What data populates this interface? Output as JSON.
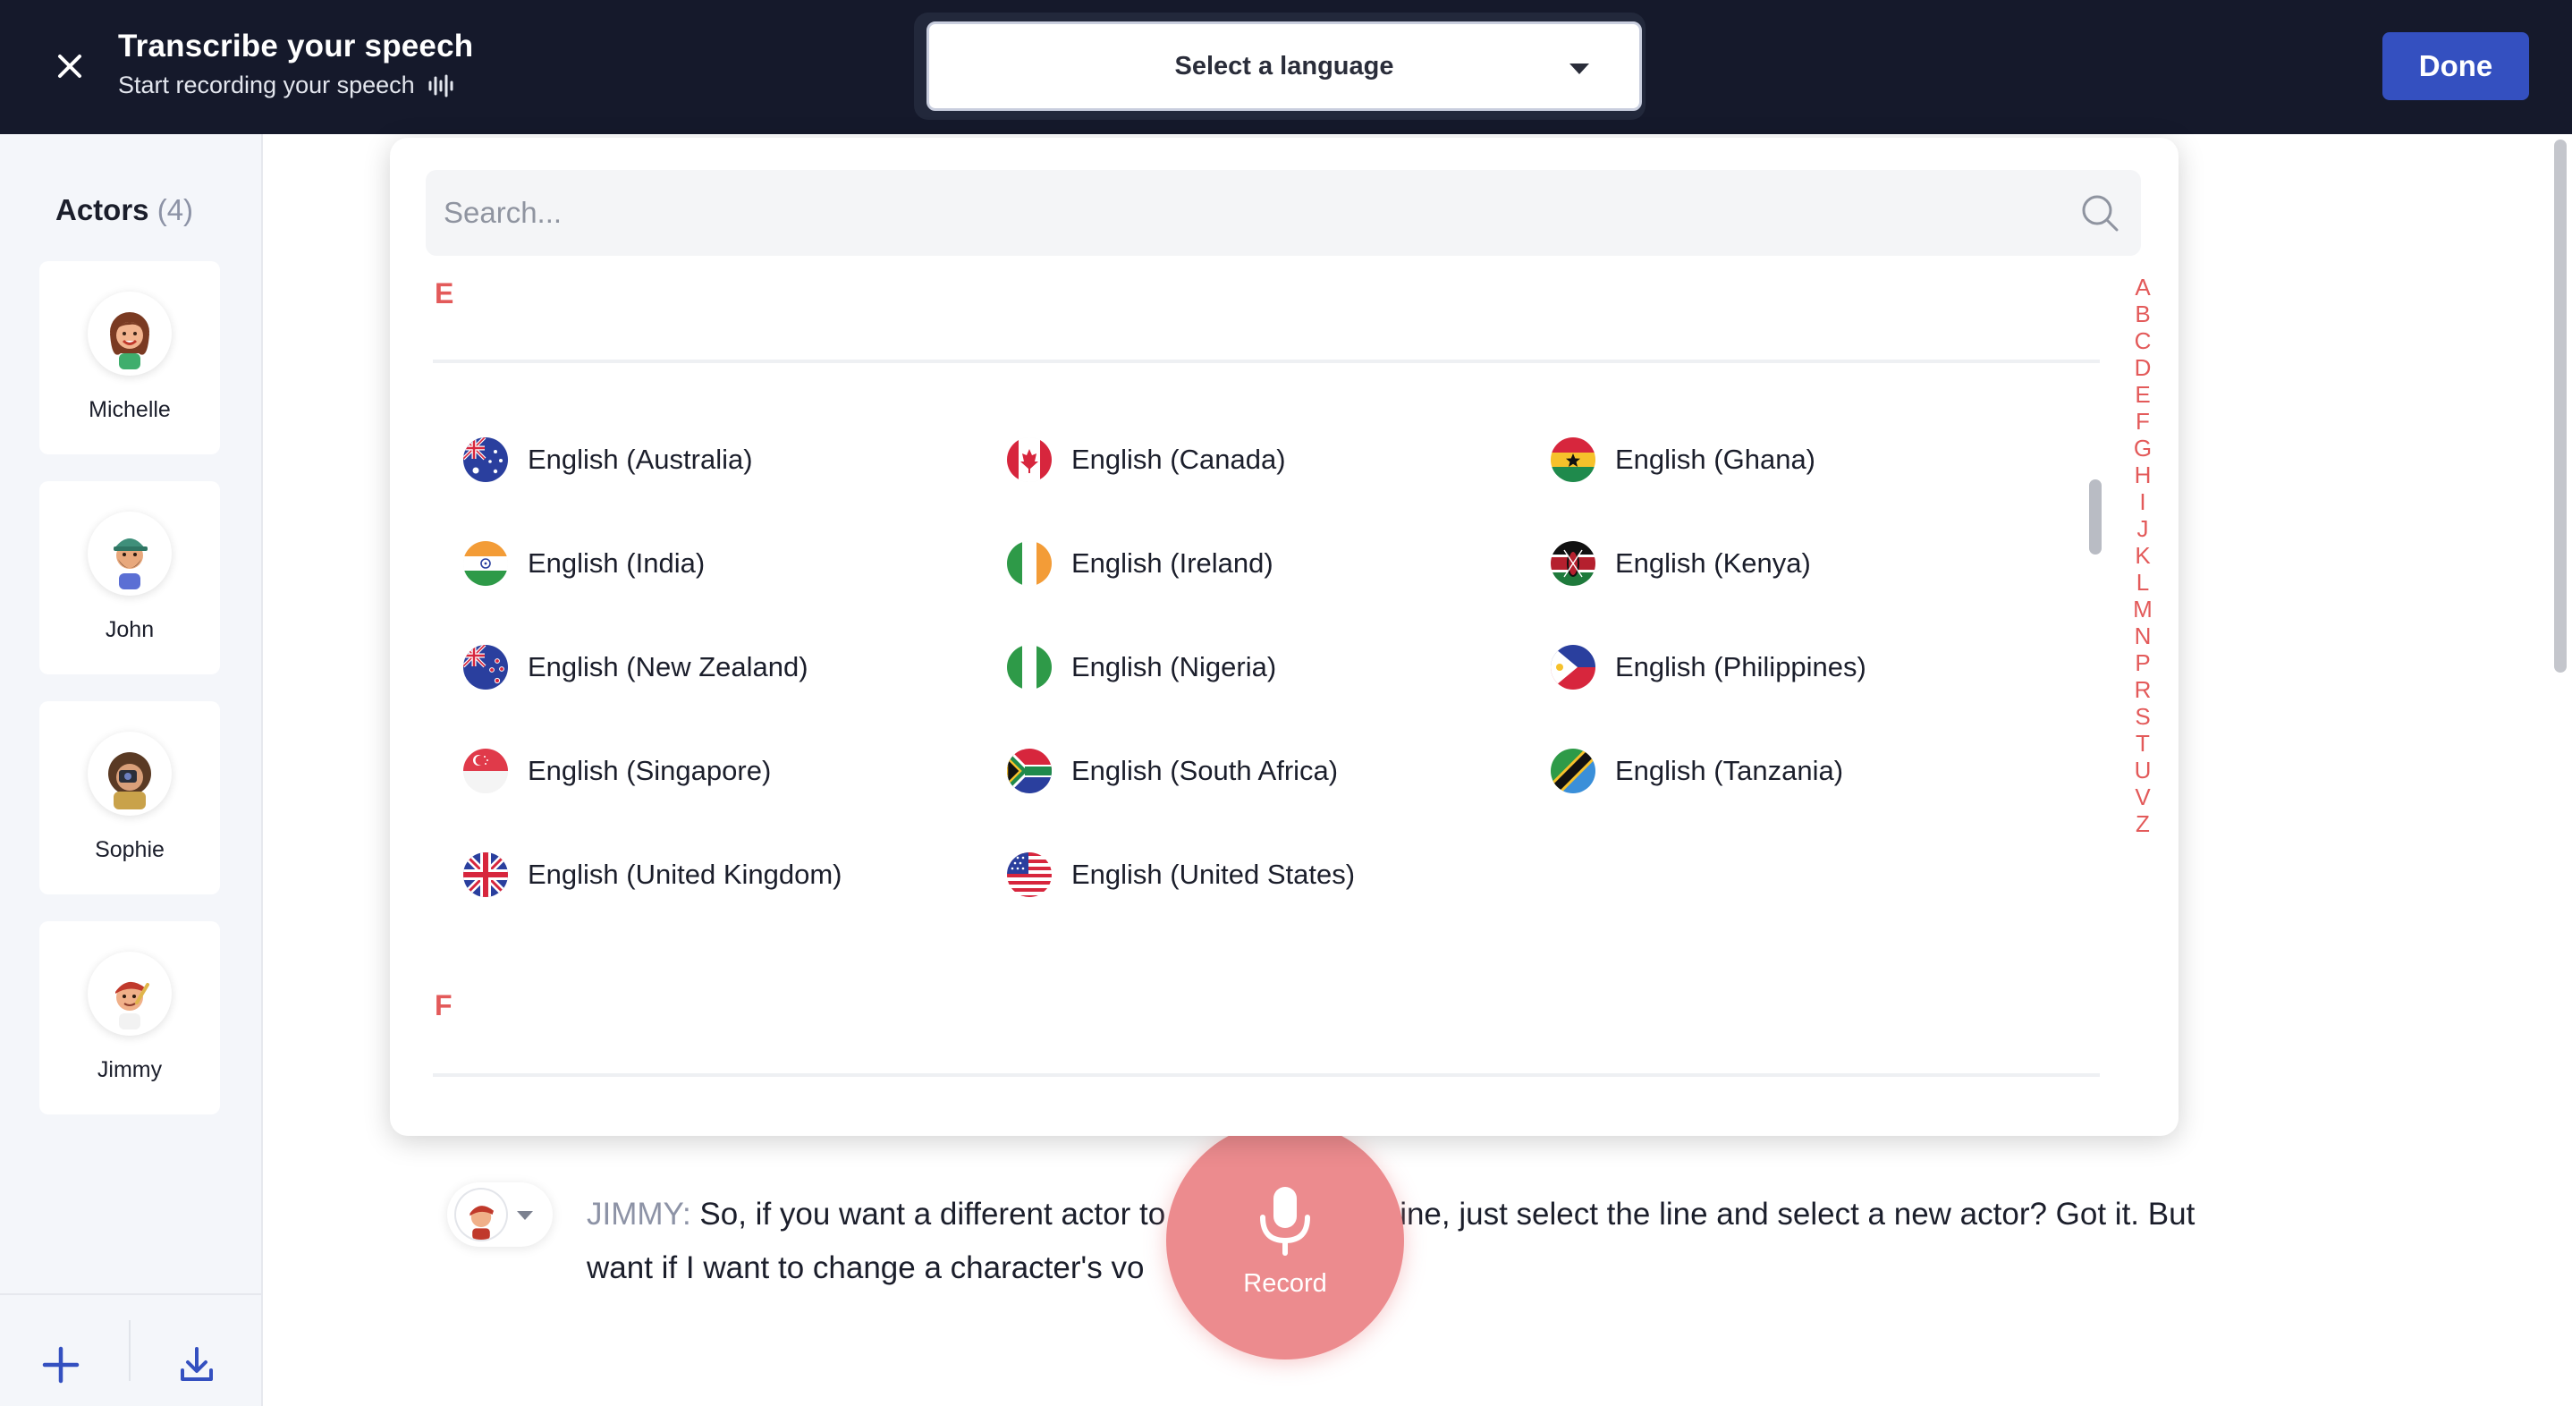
{
  "header": {
    "title": "Transcribe your speech",
    "subtitle": "Start recording your speech",
    "language_select_label": "Select a language",
    "done_label": "Done"
  },
  "sidebar": {
    "actors_title": "Actors",
    "actors_count": "(4)",
    "actors": [
      {
        "name": "Michelle"
      },
      {
        "name": "John"
      },
      {
        "name": "Sophie"
      },
      {
        "name": "Jimmy"
      }
    ]
  },
  "dropdown": {
    "search_placeholder": "Search...",
    "sections": [
      {
        "letter": "E",
        "languages": [
          {
            "label": "English (Australia)",
            "flag": "australia"
          },
          {
            "label": "English (Canada)",
            "flag": "canada"
          },
          {
            "label": "English (Ghana)",
            "flag": "ghana"
          },
          {
            "label": "English (India)",
            "flag": "india"
          },
          {
            "label": "English (Ireland)",
            "flag": "ireland"
          },
          {
            "label": "English (Kenya)",
            "flag": "kenya"
          },
          {
            "label": "English (New Zealand)",
            "flag": "new-zealand"
          },
          {
            "label": "English (Nigeria)",
            "flag": "nigeria"
          },
          {
            "label": "English (Philippines)",
            "flag": "philippines"
          },
          {
            "label": "English (Singapore)",
            "flag": "singapore"
          },
          {
            "label": "English (South Africa)",
            "flag": "south-africa"
          },
          {
            "label": "English (Tanzania)",
            "flag": "tanzania"
          },
          {
            "label": "English (United Kingdom)",
            "flag": "united-kingdom"
          },
          {
            "label": "English (United States)",
            "flag": "united-states"
          }
        ]
      },
      {
        "letter": "F",
        "languages": []
      }
    ],
    "alphabet": [
      "A",
      "B",
      "C",
      "D",
      "E",
      "F",
      "G",
      "H",
      "I",
      "J",
      "K",
      "L",
      "M",
      "N",
      "P",
      "R",
      "S",
      "T",
      "U",
      "V",
      "Z"
    ]
  },
  "transcript": {
    "speaker": "JIMMY:",
    "text_before": "So, if you want a different actor to",
    "text_after": "ine, just select the line and select a new actor? Got it. But want if I want to change a character's vo"
  },
  "record": {
    "label": "Record"
  },
  "colors": {
    "header_bg": "#15192b",
    "accent_blue": "#3450c0",
    "section_red": "#e35a5a",
    "record_pink": "#ec8b8e"
  }
}
